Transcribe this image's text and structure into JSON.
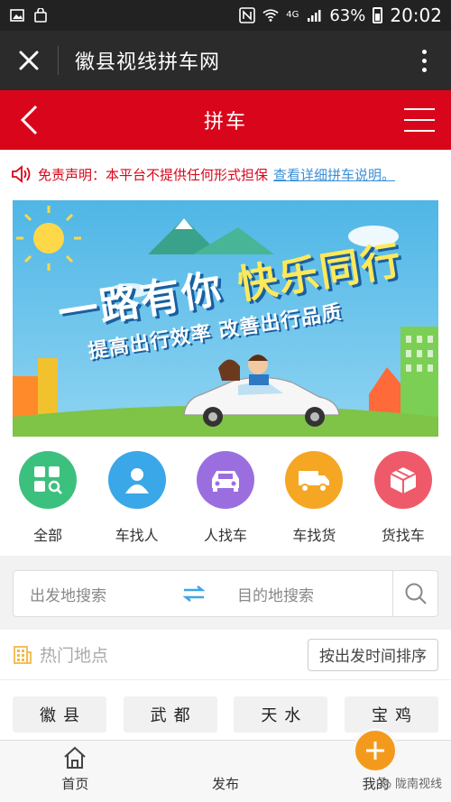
{
  "status_bar": {
    "battery": "63%",
    "time": "20:02",
    "network": "4G"
  },
  "browser": {
    "title": "徽县视线拼车网"
  },
  "header": {
    "title": "拼车"
  },
  "notice": {
    "text": "免责声明：本平台不提供任何形式担保",
    "link": "查看详细拼车说明。"
  },
  "banner": {
    "slogan_a": "一路有你",
    "slogan_b": "快乐同行",
    "subtitle": "提高出行效率 改善出行品质"
  },
  "categories": [
    {
      "label": "全部",
      "color": "#3cc07e"
    },
    {
      "label": "车找人",
      "color": "#3aa7e8"
    },
    {
      "label": "人找车",
      "color": "#9b6ee0"
    },
    {
      "label": "车找货",
      "color": "#f5a623"
    },
    {
      "label": "货找车",
      "color": "#ef5a6a"
    }
  ],
  "search": {
    "from_placeholder": "出发地搜索",
    "to_placeholder": "目的地搜索"
  },
  "hot": {
    "title": "热门地点",
    "sort_label": "按出发时间排序"
  },
  "places": [
    "徽县",
    "武都",
    "天水",
    "宝鸡"
  ],
  "nav": {
    "home": "首页",
    "publish": "发布",
    "mine": "我的",
    "watermark": "陇南视线"
  },
  "colors": {
    "brand_red": "#d9061b",
    "publish_orange": "#f39a1c",
    "link_blue": "#3a8fd8"
  }
}
